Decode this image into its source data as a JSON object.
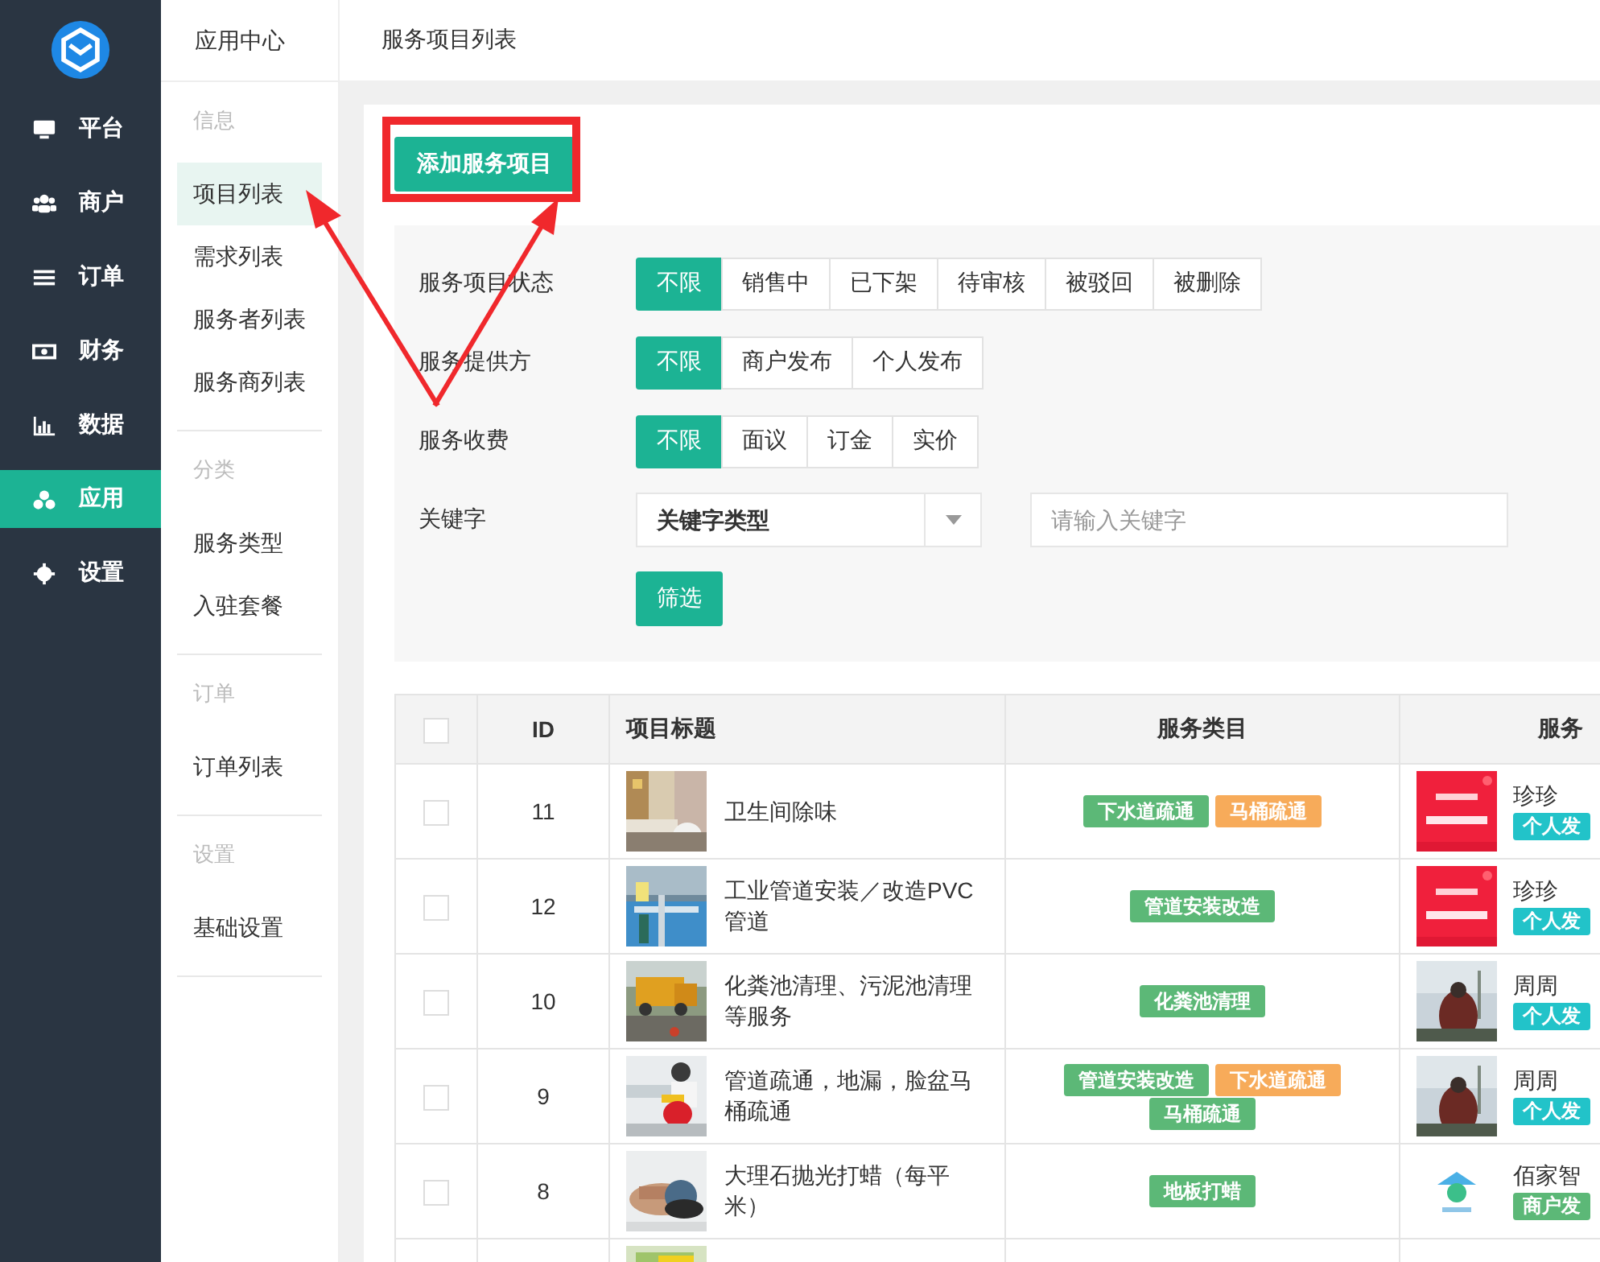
{
  "nav": [
    {
      "label": "平台",
      "kind": "monitor",
      "selected": false
    },
    {
      "label": "商户",
      "kind": "users",
      "selected": false
    },
    {
      "label": "订单",
      "kind": "list",
      "selected": false
    },
    {
      "label": "财务",
      "kind": "money",
      "selected": false
    },
    {
      "label": "数据",
      "kind": "chart",
      "selected": false
    },
    {
      "label": "应用",
      "kind": "cubes",
      "selected": true
    },
    {
      "label": "设置",
      "kind": "gear",
      "selected": false
    }
  ],
  "subnav": {
    "title": "应用中心",
    "sections": [
      {
        "title": "信息",
        "items": [
          {
            "label": "项目列表",
            "selected": true
          },
          {
            "label": "需求列表",
            "selected": false
          },
          {
            "label": "服务者列表",
            "selected": false
          },
          {
            "label": "服务商列表",
            "selected": false
          }
        ]
      },
      {
        "title": "分类",
        "items": [
          {
            "label": "服务类型",
            "selected": false
          },
          {
            "label": "入驻套餐",
            "selected": false
          }
        ]
      },
      {
        "title": "订单",
        "items": [
          {
            "label": "订单列表",
            "selected": false
          }
        ]
      },
      {
        "title": "设置",
        "items": [
          {
            "label": "基础设置",
            "selected": false
          }
        ]
      }
    ]
  },
  "page_title": "服务项目列表",
  "add_button": "添加服务项目",
  "filters": [
    {
      "label": "服务项目状态",
      "options": [
        {
          "label": "不限",
          "selected": true
        },
        {
          "label": "销售中",
          "selected": false
        },
        {
          "label": "已下架",
          "selected": false
        },
        {
          "label": "待审核",
          "selected": false
        },
        {
          "label": "被驳回",
          "selected": false
        },
        {
          "label": "被删除",
          "selected": false
        }
      ]
    },
    {
      "label": "服务提供方",
      "options": [
        {
          "label": "不限",
          "selected": true
        },
        {
          "label": "商户发布",
          "selected": false
        },
        {
          "label": "个人发布",
          "selected": false
        }
      ]
    },
    {
      "label": "服务收费",
      "options": [
        {
          "label": "不限",
          "selected": true
        },
        {
          "label": "面议",
          "selected": false
        },
        {
          "label": "订金",
          "selected": false
        },
        {
          "label": "实价",
          "selected": false
        }
      ]
    }
  ],
  "keyword": {
    "label": "关键字",
    "select_value": "关键字类型",
    "placeholder": "请输入关键字"
  },
  "filter_button": "筛选",
  "table": {
    "select_all": {
      "checked": false
    },
    "columns": [
      "ID",
      "项目标题",
      "服务类目",
      "服务"
    ],
    "rows": [
      {
        "checked": false,
        "id": "11",
        "title": "卫生间除味",
        "thumbnail": {
          "kind": "picture"
        },
        "categories": [
          {
            "label": "下水道疏通",
            "color": "#5cb877"
          },
          {
            "label": "马桶疏通",
            "color": "#f7ab5a"
          }
        ],
        "provider": {
          "name": "珍珍",
          "avatar": {
            "kind": "picture"
          },
          "tag": {
            "label": "个人发",
            "color": "#22c3c9"
          }
        }
      },
      {
        "checked": false,
        "id": "12",
        "title": "工业管道安装／改造PVC管道",
        "thumbnail": {
          "kind": "picture"
        },
        "categories": [
          {
            "label": "管道安装改造",
            "color": "#5cb877"
          }
        ],
        "provider": {
          "name": "珍珍",
          "avatar": {
            "kind": "picture"
          },
          "tag": {
            "label": "个人发",
            "color": "#22c3c9"
          }
        }
      },
      {
        "checked": false,
        "id": "10",
        "title": "化粪池清理、污泥池清理等服务",
        "thumbnail": {
          "kind": "picture"
        },
        "categories": [
          {
            "label": "化粪池清理",
            "color": "#5cb877"
          }
        ],
        "provider": {
          "name": "周周",
          "avatar": {
            "kind": "picture"
          },
          "tag": {
            "label": "个人发",
            "color": "#22c3c9"
          }
        }
      },
      {
        "checked": false,
        "id": "9",
        "title": "管道疏通，地漏，脸盆马桶疏通",
        "thumbnail": {
          "kind": "picture"
        },
        "categories": [
          {
            "label": "管道安装改造",
            "color": "#5cb877"
          },
          {
            "label": "下水道疏通",
            "color": "#f7ab5a"
          },
          {
            "label": "马桶疏通",
            "color": "#5cb877"
          }
        ],
        "provider": {
          "name": "周周",
          "avatar": {
            "kind": "picture"
          },
          "tag": {
            "label": "个人发",
            "color": "#22c3c9"
          }
        }
      },
      {
        "checked": false,
        "id": "8",
        "title": "大理石抛光打蜡（每平米）",
        "thumbnail": {
          "kind": "picture"
        },
        "categories": [
          {
            "label": "地板打蜡",
            "color": "#5cb877"
          }
        ],
        "provider": {
          "name": "佰家智",
          "avatar": {
            "kind": "logo"
          },
          "tag": {
            "label": "商户发",
            "color": "#5cb877"
          }
        }
      },
      {
        "thumbnail": {
          "kind": "picture"
        }
      }
    ]
  }
}
